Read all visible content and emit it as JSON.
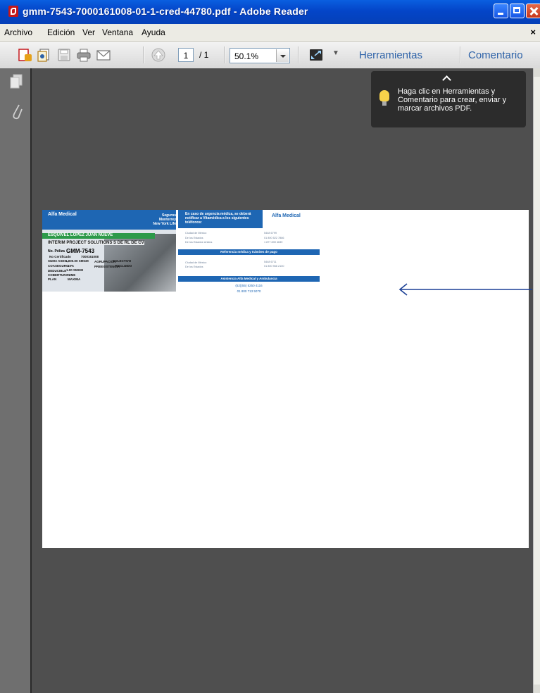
{
  "window": {
    "title": "gmm-7543-7000161008-01-1-cred-44780.pdf - Adobe Reader"
  },
  "menu": {
    "items": [
      {
        "label": "Archivo"
      },
      {
        "label": "Edición"
      },
      {
        "label": "Ver"
      },
      {
        "label": "Ventana"
      },
      {
        "label": "Ayuda"
      }
    ],
    "close_doc": "×"
  },
  "toolbar": {
    "icons": [
      "create-pdf-icon",
      "combine-icon",
      "save-icon",
      "print-icon",
      "email-icon",
      "prev-page-icon",
      "fit-page-icon"
    ],
    "page_current": "1",
    "page_total": "/ 1",
    "zoom": "50.1%",
    "more": "▼",
    "tools_label": "Herramientas",
    "comment_label": "Comentario"
  },
  "tooltip": {
    "text": "Haga clic en Herramientas y Comentario para crear, enviar y marcar archivos PDF."
  },
  "card_front": {
    "brand": "Alfa Medical",
    "insurer": "Seguros Monterrey",
    "insurer_sub": "New York Life",
    "name": "ESQUIVEL LOPEZ JUAN NUEVE",
    "company": "INTERIM PROJECT SOLUTIONS S DE RL DE CV",
    "poliza_label": "No. Póliza",
    "poliza_value": "GMM-7543",
    "cert_label": "No Certificado",
    "cert_value": "7000161008",
    "suma_label": "SUMA ASEG.:",
    "suma_value": "1,000.00 SMGM",
    "agrup_label": "AGRUPACION",
    "agrup_value": "COLECTIVO",
    "coaseguro_label": "COASEGURO",
    "coaseguro_value": "10%",
    "preex_label": "PREEXISTENCIA",
    "preex_value": "EXCLUIDO",
    "deducible_label": "DEDUCIBLE",
    "deducible_value": "1.00 SMGM",
    "cobertura_label": "COBERTURA",
    "cobertura_value": "NIME",
    "plan_label": "PLAN",
    "plan_value": "MAXIMA"
  },
  "card_back": {
    "urgency_text": "En caso de urgencia médica, se deberá notificar a Vitamédica a los siguientes teléfonos:",
    "brand": "Alfa Medical",
    "rows1": [
      {
        "label": "Ciudad de México",
        "value": "5448 6799"
      },
      {
        "label": "De los Estados",
        "value": "01 800 522 7886"
      },
      {
        "label": "De los Estados Unidos",
        "value": "1 877 839 4639"
      }
    ],
    "band1": "Referencia médica y trámites de pago",
    "rows2": [
      {
        "label": "Ciudad de México",
        "value": "5448 6711"
      },
      {
        "label": "De los Estados",
        "value": "01 800 966 2100"
      }
    ],
    "band2": "Asistencia Alfa Medical y Ambulancia",
    "phone1": "(52)(55) 5250 4116",
    "phone2": "01 800 713 5070"
  }
}
